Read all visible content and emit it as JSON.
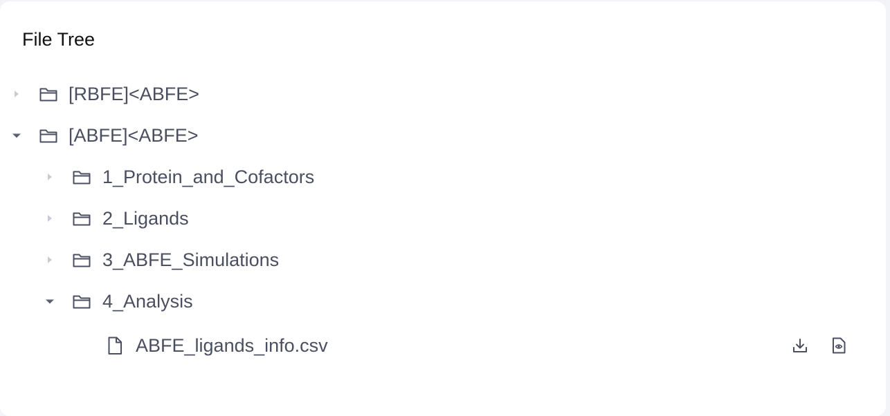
{
  "panel": {
    "title": "File Tree"
  },
  "tree": {
    "items": [
      {
        "label": "[RBFE]<ABFE>",
        "type": "folder",
        "expanded": false,
        "depth": 0
      },
      {
        "label": "[ABFE]<ABFE>",
        "type": "folder",
        "expanded": true,
        "depth": 0
      },
      {
        "label": "1_Protein_and_Cofactors",
        "type": "folder",
        "expanded": false,
        "depth": 1
      },
      {
        "label": "2_Ligands",
        "type": "folder",
        "expanded": false,
        "depth": 1
      },
      {
        "label": "3_ABFE_Simulations",
        "type": "folder",
        "expanded": false,
        "depth": 1
      },
      {
        "label": "4_Analysis",
        "type": "folder",
        "expanded": true,
        "depth": 1
      },
      {
        "label": "ABFE_ligands_info.csv",
        "type": "file",
        "depth": 2,
        "actions": [
          "download-icon",
          "preview-icon"
        ]
      }
    ]
  },
  "colors": {
    "text": "#4a4f60",
    "icon": "#4a4f60",
    "caret_collapsed": "#c9cbd6",
    "caret_expanded": "#5d6273"
  }
}
